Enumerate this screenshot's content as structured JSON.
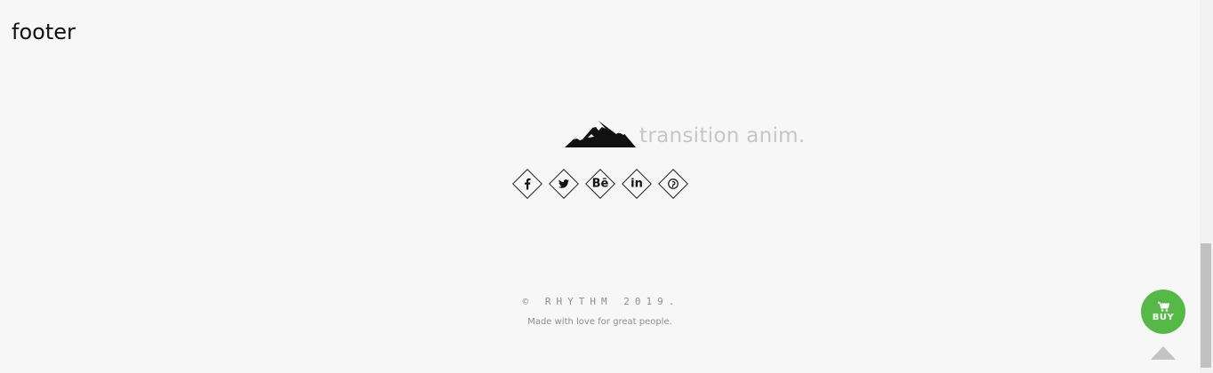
{
  "page": {
    "heading": "footer"
  },
  "brand": {
    "name": "transition anim.",
    "logo_icon": "mountain-icon"
  },
  "social": [
    {
      "name": "facebook",
      "icon": "facebook-icon"
    },
    {
      "name": "twitter",
      "icon": "twitter-icon"
    },
    {
      "name": "behance",
      "icon": "behance-icon",
      "glyph": "Bē"
    },
    {
      "name": "linkedin",
      "icon": "linkedin-icon",
      "glyph": "in"
    },
    {
      "name": "pinterest",
      "icon": "pinterest-icon"
    }
  ],
  "footer": {
    "copyright": "© RHYTHM 2019.",
    "tagline": "Made with love for great people."
  },
  "buy": {
    "label": "BUY",
    "icon": "cart-icon",
    "color": "#56b947"
  },
  "scroll_top": {
    "icon": "arrow-up-icon"
  }
}
